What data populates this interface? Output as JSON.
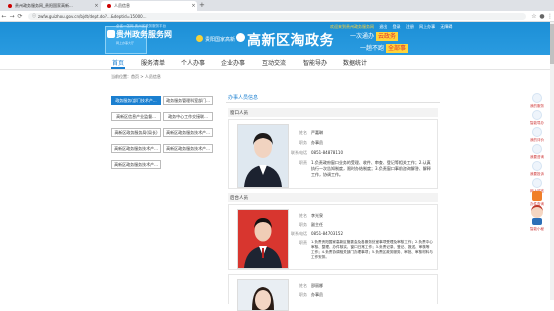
{
  "browser": {
    "tabs": [
      {
        "title": "贵州政务服务网_贵阳国家高新...",
        "active": false
      },
      {
        "title": "人员信息",
        "active": true
      }
    ],
    "url": "zwfw.guizhou.gov.cn/bjdt/dept.do?...&deptid=15000..."
  },
  "banner": {
    "logo_sub": "全省一张网 贵州省政务服务平台",
    "logo_main": "贵州政务服务网",
    "logo_en": "网上办事大厅",
    "region": "贵阳国家高新",
    "slogan": "高新区淘政务",
    "slogan2_prefix": "一次通办",
    "slogan2_hl": "云政务",
    "slogan3_prefix": "一趟不跑",
    "slogan3_hl": "全部事",
    "toplinks": [
      "欢迎来到贵州政务服务网",
      "退出",
      "登录",
      "注册",
      "网上办事",
      "无障碍"
    ]
  },
  "nav": {
    "items": [
      "首页",
      "服务清单",
      "个人办事",
      "企业办事",
      "互动交流",
      "智能导办",
      "数据统计"
    ],
    "active": 0
  },
  "breadcrumb": "当前位置：首页 > 人员信息",
  "menu": {
    "items": [
      "政务服务(部门技术产...",
      "政务服务管理科室部门...",
      "高新区信息产业监督...",
      "政务中心工作交接联...",
      "高新区政务服务局(局长)",
      "高新区政务服务技术产...",
      "高新区政务服务技术产...",
      "高新区政务服务技术产...",
      "高新区政务服务技术产..."
    ],
    "active": 0
  },
  "content": {
    "title": "办事人员信息",
    "sections": [
      {
        "heading": "窗口人员",
        "labels": [
          "姓名",
          "职务",
          "联系电话",
          "职责"
        ],
        "name": "严嘉琳",
        "position": "办事员",
        "phone": "0851-84878110",
        "duty": "1.负责政府窗口业务的受理、收件、审查、登记等相关工作；2.认真执行一次告知制度，限时办结制度；3.负责窗口事前咨询解答、解释工作，协调工作。"
      },
      {
        "heading": "后台人员",
        "labels": [
          "姓名",
          "职务",
          "联系电话",
          "职责"
        ],
        "name": "李光泉",
        "position": "副主任",
        "phone": "0851-84703152",
        "duty": "1.负责贵阳国家高新区管委会及各服务处室事项受理及审核工作；2.负责中心审核、整理、办件核实、窗口日常工作；3.负责记录、登记、报送、审核等工作；4.负责协调相关部门办理事项；5.负责区政务服务、审批、审核材料与工作安排。"
      },
      {
        "heading": "",
        "labels": [
          "姓名",
          "职务"
        ],
        "name": "邵丽娜",
        "position": "办事员"
      }
    ]
  },
  "floating": [
    "我的服务",
    "智能导办",
    "我的评价",
    "我要咨询",
    "我要投诉",
    "网上留言",
    "办件查询",
    "智能小秘"
  ]
}
